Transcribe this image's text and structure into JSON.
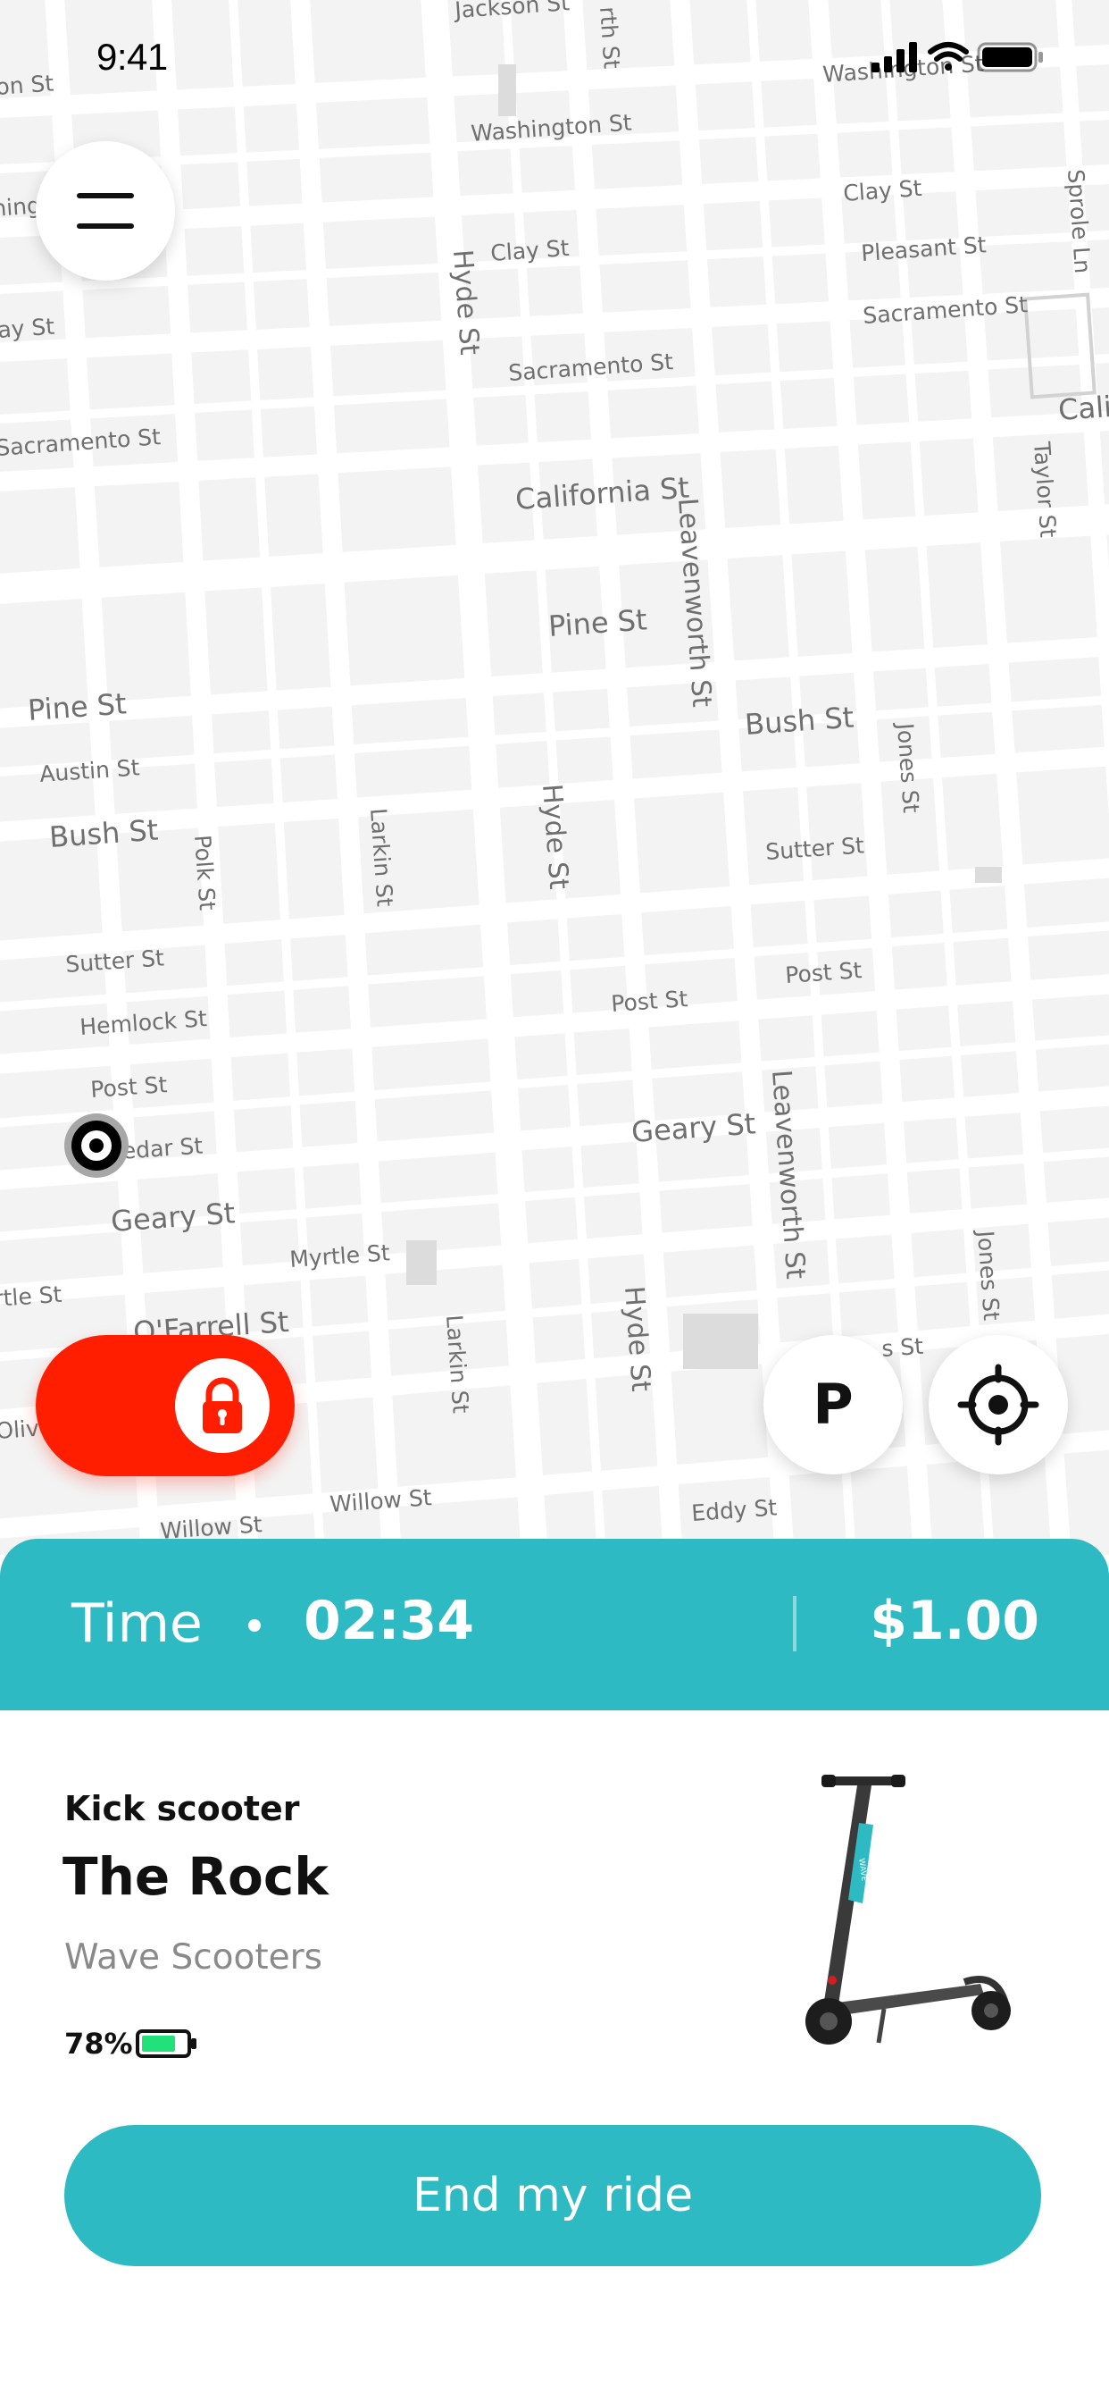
{
  "status_bar": {
    "time": "9:41",
    "icons": [
      "cellular-signal-icon",
      "wifi-icon",
      "battery-icon"
    ]
  },
  "map": {
    "streets": [
      "Jackson St",
      "Washington St",
      "Washington St",
      "Clay St",
      "Clay St",
      "Pleasant St",
      "Sacramento St",
      "Sacramento St",
      "Sacramento St",
      "California St",
      "Pine St",
      "Pine St",
      "Austin St",
      "Bush St",
      "Bush St",
      "Sutter St",
      "Sutter St",
      "Hemlock St",
      "Post St",
      "Post St",
      "Post St",
      "Cedar St",
      "Geary St",
      "Geary St",
      "Myrtle St",
      "O'Farrell St",
      "Willow St",
      "Willow St",
      "Eddy St",
      "Hyde St",
      "Hyde St",
      "Hyde St",
      "Larkin St",
      "Larkin St",
      "Polk St",
      "Leavenworth St",
      "Leavenworth St",
      "Jones St",
      "Jones St",
      "Taylor St",
      "Sprole Ln",
      "Cali",
      "Olive",
      "rth St",
      "ay St",
      "on St",
      "ning",
      "rtle St",
      "s St"
    ]
  },
  "buttons": {
    "menu": "menu",
    "parking_label": "P",
    "locate": "locate"
  },
  "ride": {
    "time_label": "Time",
    "time_value": "02:34",
    "price": "$1.00"
  },
  "vehicle": {
    "type": "Kick scooter",
    "name": "The Rock",
    "company": "Wave Scooters",
    "battery": "78%",
    "battery_level": 0.78,
    "scooter_brand": "WAVE"
  },
  "end_button": "End my ride",
  "colors": {
    "accent": "#2ebac3",
    "lock": "#ff1e00",
    "battery": "#22e07a"
  }
}
